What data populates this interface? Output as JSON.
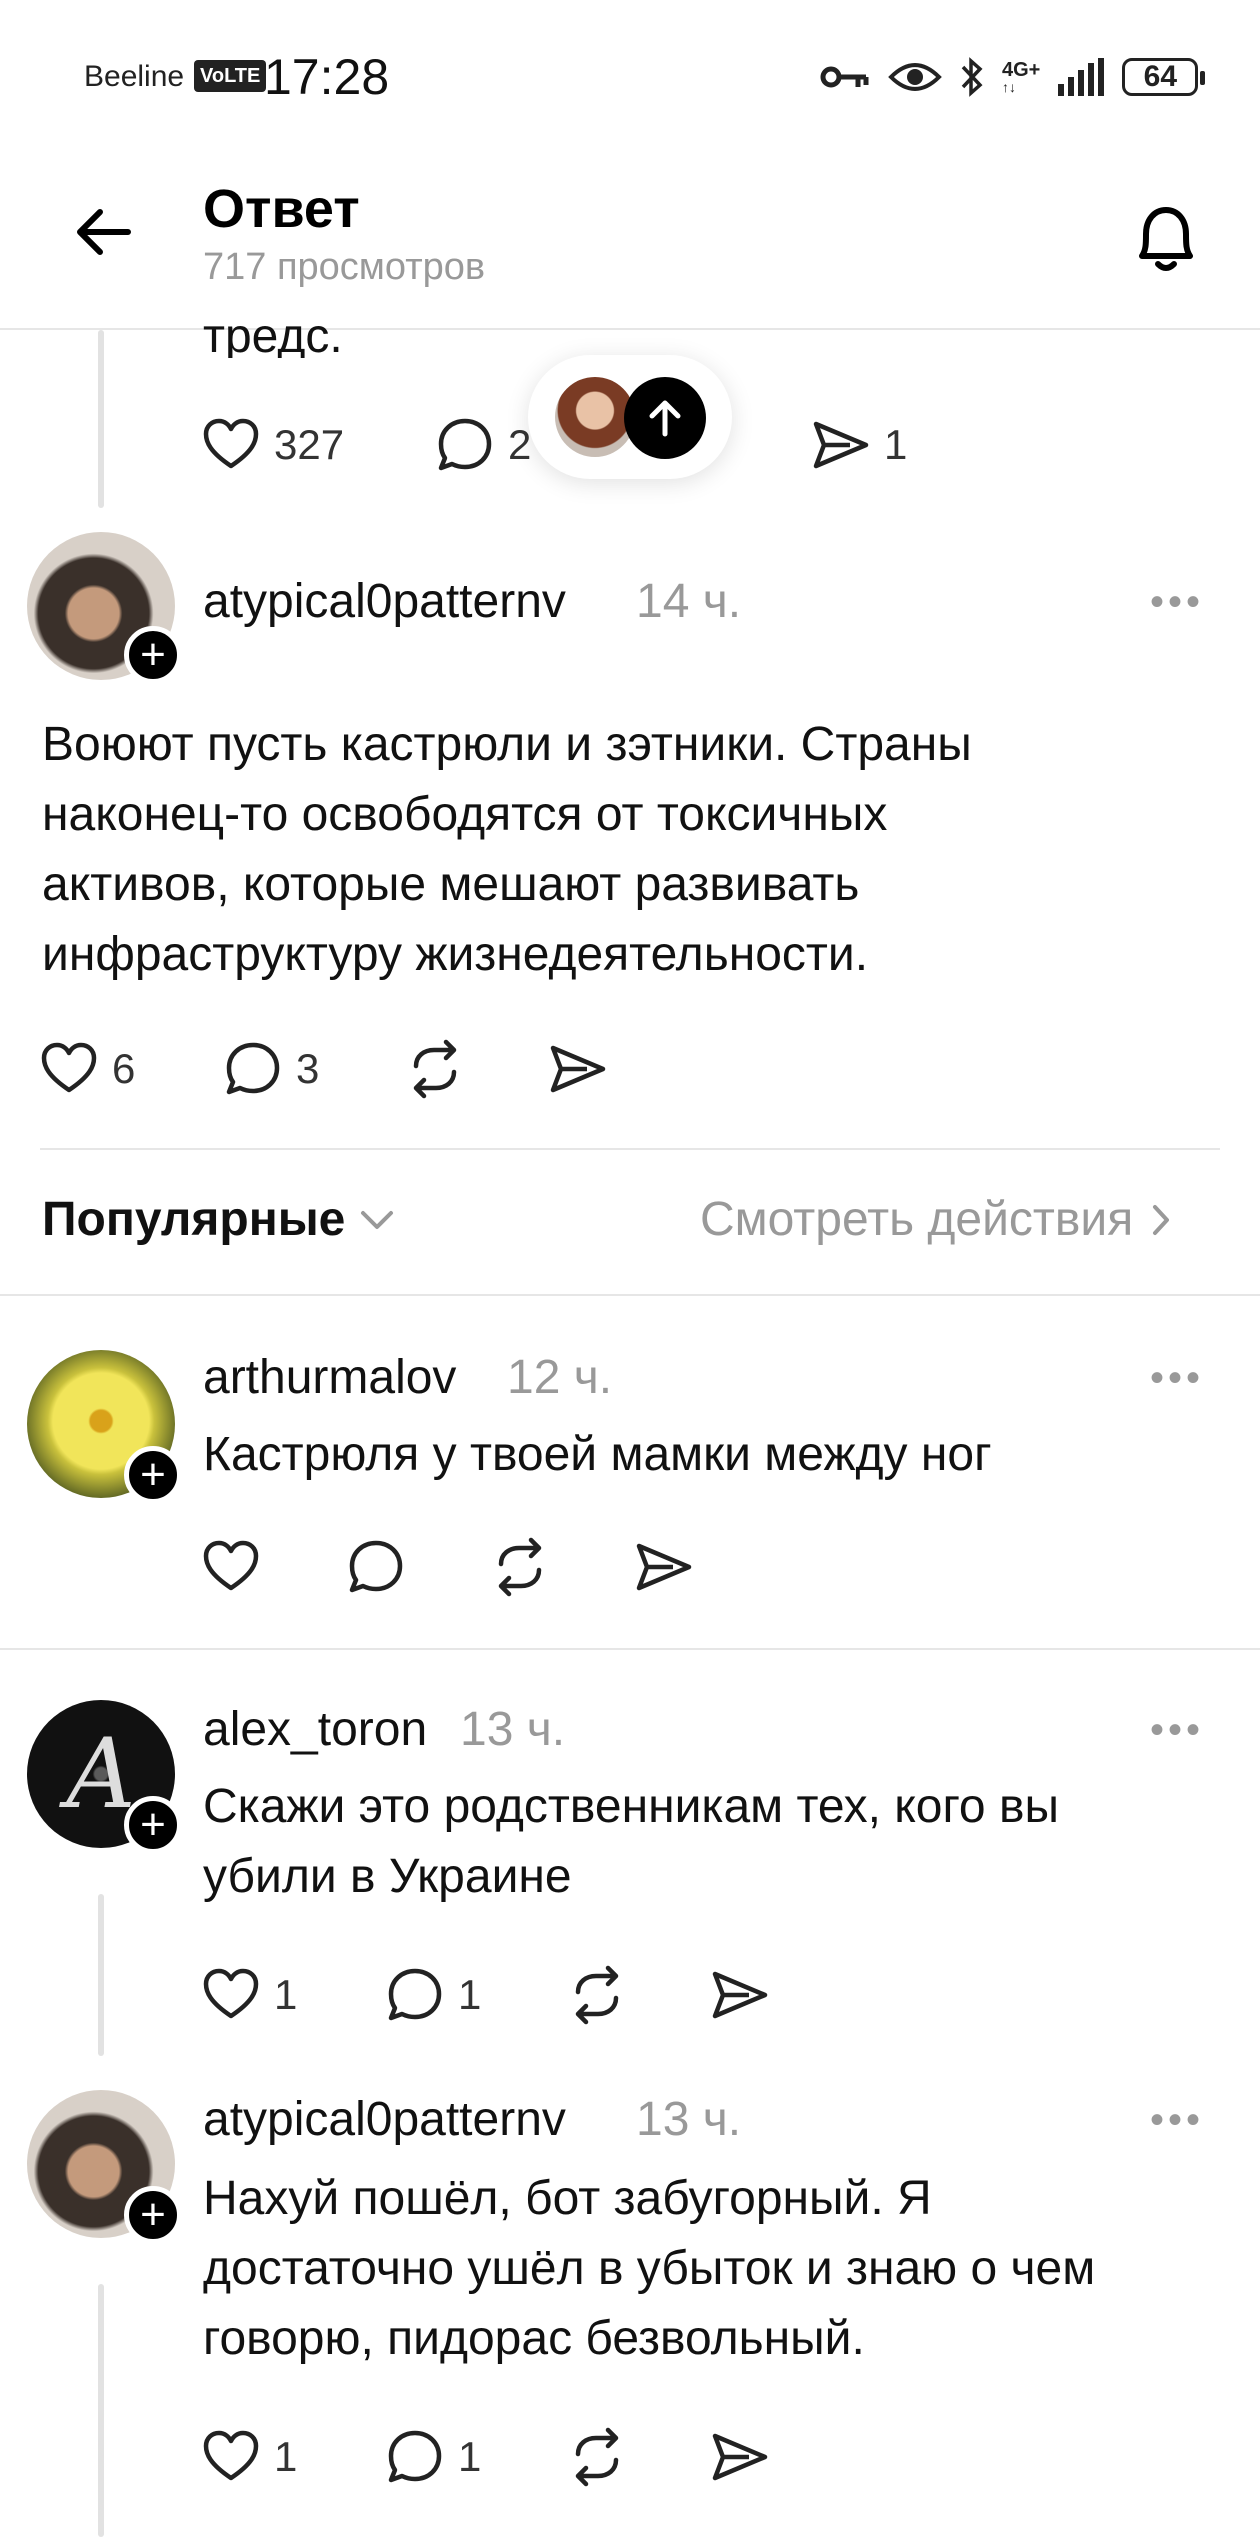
{
  "status_bar": {
    "carrier": "Beeline",
    "volte": "VoLTE",
    "time": "17:28",
    "network": "4G+",
    "battery": "64"
  },
  "header": {
    "title": "Ответ",
    "views": "717 просмотров"
  },
  "parent_post": {
    "text_tail": "тредс.",
    "likes": "327",
    "comments": "2",
    "shares": "1"
  },
  "main_post": {
    "username": "atypical0patternv",
    "time": "14 ч.",
    "text": "Воюют пусть кастрюли и зэтники. Страны наконец-то освободятся от токсичных активов, которые мешают развивать инфраструктуру жизнедеятельности.",
    "likes": "6",
    "comments": "3"
  },
  "sort_bar": {
    "sort_label": "Популярные",
    "activity_link": "Смотреть действия"
  },
  "replies": [
    {
      "username": "arthurmalov",
      "time": "12 ч.",
      "text": "Кастрюля у твоей мамки между ног",
      "likes": "",
      "comments": ""
    },
    {
      "username": "alex_toron",
      "time": "13 ч.",
      "text": "Скажи это родственникам тех, кого вы убили в Украине",
      "likes": "1",
      "comments": "1"
    },
    {
      "username": "atypical0patternv",
      "time": "13 ч.",
      "text": "Нахуй пошёл, бот забугорный. Я достаточно ушёл в убыток и знаю о чем говорю, пидорас безвольный.",
      "likes": "1",
      "comments": "1"
    }
  ],
  "icons": {
    "back": "arrow-left-icon",
    "bell": "bell-icon",
    "like": "heart-icon",
    "comment": "comment-bubble-icon",
    "repost": "repost-icon",
    "share": "send-icon",
    "more": "more-dots-icon",
    "follow": "plus-icon"
  },
  "colors": {
    "text": "#111111",
    "muted": "#999999",
    "divider": "#e6e6e6"
  }
}
